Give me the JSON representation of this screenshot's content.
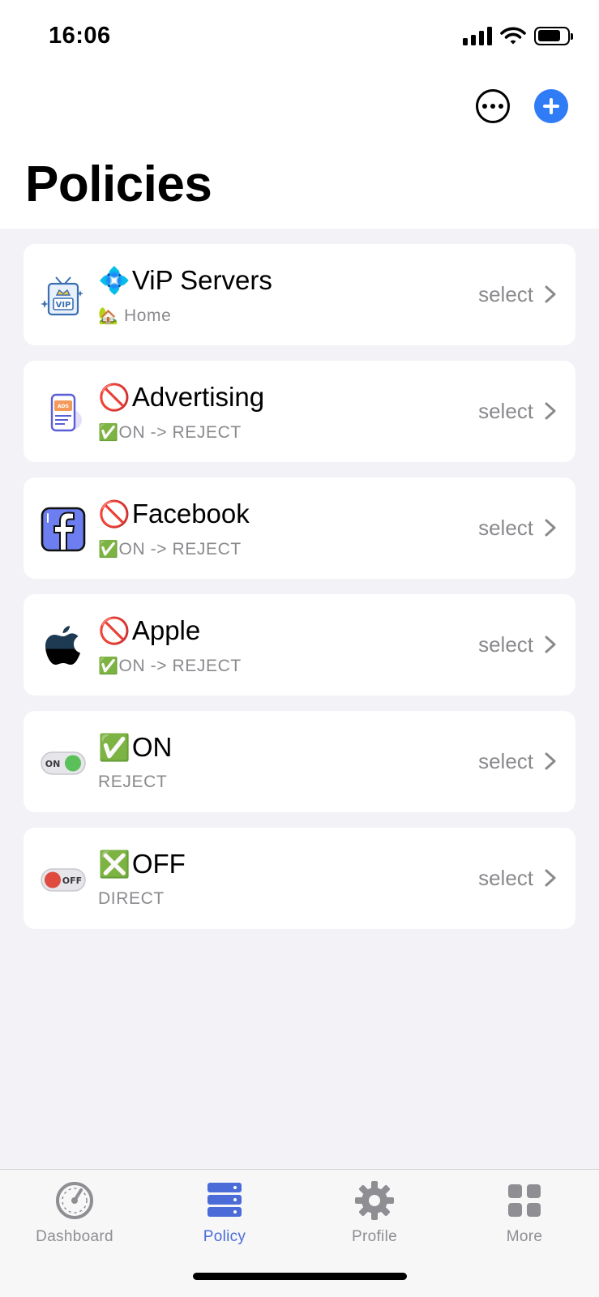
{
  "status_bar": {
    "time": "16:06"
  },
  "header": {
    "title": "Policies"
  },
  "policies": [
    {
      "icon": "vip-tv-icon",
      "title_emoji": "💠",
      "title": "ViP Servers",
      "subtitle_emoji": "🏡",
      "subtitle": " Home",
      "type": "select"
    },
    {
      "icon": "advertising-phone-icon",
      "title_emoji": "🚫",
      "title": " Advertising",
      "subtitle_emoji": "✅",
      "subtitle": "ON -> REJECT",
      "type": "select"
    },
    {
      "icon": "facebook-icon",
      "title_emoji": "🚫",
      "title": " Facebook",
      "subtitle_emoji": "✅",
      "subtitle": "ON -> REJECT",
      "type": "select"
    },
    {
      "icon": "apple-icon",
      "title_emoji": "🚫",
      "title": " Apple",
      "subtitle_emoji": "✅",
      "subtitle": "ON -> REJECT",
      "type": "select"
    },
    {
      "icon": "toggle-on-icon",
      "title_emoji": "✅",
      "title": "ON",
      "subtitle_emoji": "",
      "subtitle": "REJECT",
      "type": "select"
    },
    {
      "icon": "toggle-off-icon",
      "title_emoji": "❎",
      "title": " OFF",
      "subtitle_emoji": "",
      "subtitle": "DIRECT",
      "type": "select"
    }
  ],
  "toggle_labels": {
    "on": "ON",
    "off": "OFF"
  },
  "tabs": [
    {
      "label": "Dashboard",
      "icon": "dashboard-gauge-icon",
      "active": false
    },
    {
      "label": "Policy",
      "icon": "policy-server-icon",
      "active": true
    },
    {
      "label": "Profile",
      "icon": "gear-icon",
      "active": false
    },
    {
      "label": "More",
      "icon": "grid-icon",
      "active": false
    }
  ],
  "colors": {
    "accent": "#2f7cf6",
    "active_tab": "#4b6bd8",
    "secondary_text": "#8a8a8e",
    "background": "#f2f2f7"
  }
}
